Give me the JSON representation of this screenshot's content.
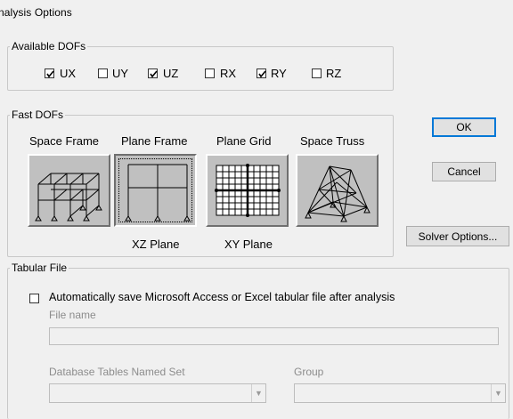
{
  "window": {
    "title": "nalysis Options"
  },
  "available_dofs": {
    "label": "Available DOFs",
    "items": [
      {
        "label": "UX",
        "checked": true
      },
      {
        "label": "UY",
        "checked": false
      },
      {
        "label": "UZ",
        "checked": true
      },
      {
        "label": "RX",
        "checked": false
      },
      {
        "label": "RY",
        "checked": true
      },
      {
        "label": "RZ",
        "checked": false
      }
    ]
  },
  "fast_dofs": {
    "label": "Fast DOFs",
    "options": [
      {
        "label": "Space Frame",
        "icon": "space-frame-icon",
        "sublabel": ""
      },
      {
        "label": "Plane Frame",
        "icon": "plane-frame-icon",
        "sublabel": "XZ Plane",
        "selected": true
      },
      {
        "label": "Plane Grid",
        "icon": "plane-grid-icon",
        "sublabel": "XY Plane"
      },
      {
        "label": "Space Truss",
        "icon": "space-truss-icon",
        "sublabel": ""
      }
    ]
  },
  "buttons": {
    "ok": "OK",
    "cancel": "Cancel",
    "solver_options": "Solver Options..."
  },
  "tabular_file": {
    "label": "Tabular File",
    "auto_save_label": "Automatically save Microsoft Access or Excel tabular file after analysis",
    "auto_save_checked": false,
    "file_name_label": "File name",
    "file_name_value": "",
    "db_tables_label": "Database Tables Named Set",
    "db_tables_value": "",
    "group_label": "Group",
    "group_value": ""
  },
  "colors": {
    "button_face": "#c0c0c0",
    "focus_blue": "#0078d7",
    "group_border": "#c8c8c8"
  }
}
